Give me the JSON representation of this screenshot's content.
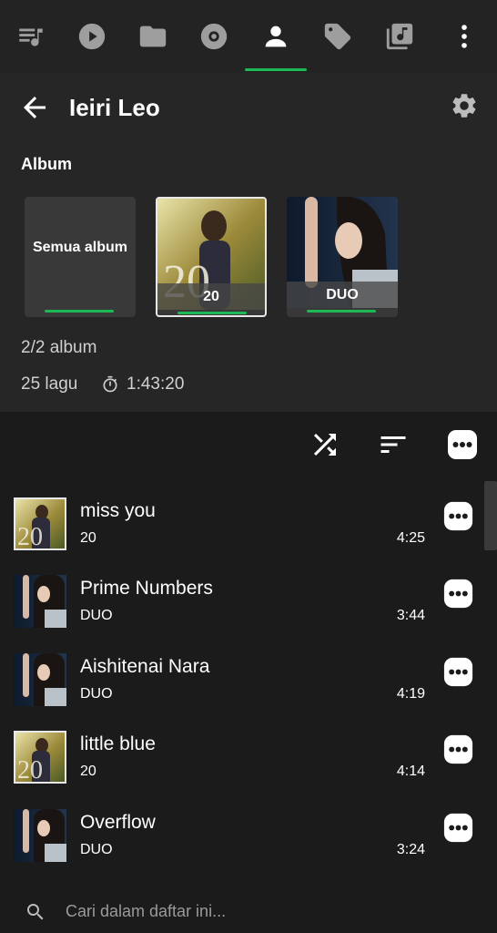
{
  "tabs": [
    {
      "name": "playlists",
      "icon": "queue-music-icon"
    },
    {
      "name": "now-playing",
      "icon": "play-circle-icon"
    },
    {
      "name": "folders",
      "icon": "folder-icon"
    },
    {
      "name": "albums",
      "icon": "album-disc-icon"
    },
    {
      "name": "artists",
      "icon": "person-icon",
      "active": true
    },
    {
      "name": "genres",
      "icon": "tag-icon"
    },
    {
      "name": "library",
      "icon": "music-library-icon"
    },
    {
      "name": "menu",
      "icon": "more-vert-icon"
    }
  ],
  "header": {
    "title": "Ieiri Leo",
    "section_label": "Album",
    "album_count": "2/2 album",
    "song_count": "25 lagu",
    "total_duration": "1:43:20"
  },
  "albums": [
    {
      "label": "Semua album"
    },
    {
      "label": "20"
    },
    {
      "label": "DUO"
    }
  ],
  "tracks": [
    {
      "title": "miss you",
      "album": "20",
      "duration": "4:25"
    },
    {
      "title": "Prime Numbers",
      "album": "DUO",
      "duration": "3:44"
    },
    {
      "title": "Aishitenai Nara",
      "album": "DUO",
      "duration": "4:19"
    },
    {
      "title": "little blue",
      "album": "20",
      "duration": "4:14"
    },
    {
      "title": "Overflow",
      "album": "DUO",
      "duration": "3:24"
    }
  ],
  "search": {
    "placeholder": "Cari dalam daftar ini..."
  },
  "colors": {
    "accent": "#1db954",
    "background": "#1b1b1b",
    "header_bg": "#262626",
    "icon": "#bdbdbd"
  }
}
